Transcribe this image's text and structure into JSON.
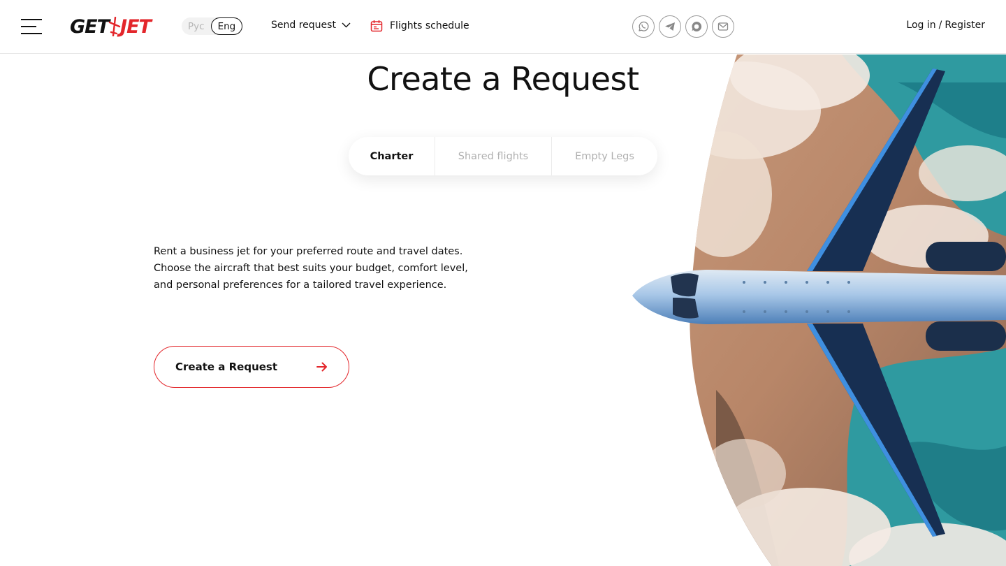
{
  "brand": {
    "get": "GET",
    "jet": "JET",
    "accent": "#e3262b"
  },
  "lang": {
    "ru": "Рус",
    "en": "Eng",
    "active": "Eng"
  },
  "nav": {
    "send_request": "Send request",
    "flights_schedule": "Flights schedule"
  },
  "socials": [
    "whatsapp-icon",
    "telegram-icon",
    "chat-icon",
    "mail-icon"
  ],
  "auth": {
    "login": "Log in",
    "separator": "/",
    "register": "Register"
  },
  "hero": {
    "title": "Create a Request",
    "tabs": [
      {
        "label": "Charter",
        "active": true
      },
      {
        "label": "Shared flights",
        "active": false
      },
      {
        "label": "Empty Legs",
        "active": false
      }
    ],
    "description": [
      "Rent a business jet for your preferred route and travel dates.",
      "Choose the aircraft that best suits your budget, comfort level,",
      "and personal preferences for a tailored travel experience."
    ],
    "cta_label": "Create a Request"
  }
}
